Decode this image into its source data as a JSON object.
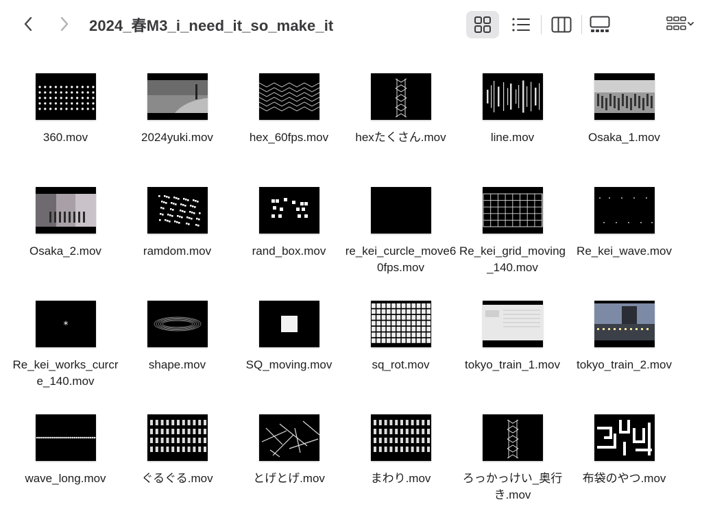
{
  "window": {
    "title": "2024_春M3_i_need_it_so_make_it"
  },
  "toolbar": {
    "back_icon": "chevron-left-icon",
    "forward_icon": "chevron-right-icon",
    "views": [
      {
        "icon": "icon-view-grid-icon",
        "active": true
      },
      {
        "icon": "list-view-icon",
        "active": false
      },
      {
        "icon": "column-view-icon",
        "active": false
      },
      {
        "icon": "gallery-view-icon",
        "active": false
      }
    ],
    "group_icon": "group-by-icon"
  },
  "files": [
    {
      "name": "360.mov",
      "thumb": "dots"
    },
    {
      "name": "2024yuki.mov",
      "thumb": "snow"
    },
    {
      "name": "hex_60fps.mov",
      "thumb": "zigzag"
    },
    {
      "name": "hexたくさん.mov",
      "thumb": "hexchain"
    },
    {
      "name": "line.mov",
      "thumb": "bars"
    },
    {
      "name": "Osaka_1.mov",
      "thumb": "crowd"
    },
    {
      "name": "Osaka_2.mov",
      "thumb": "street"
    },
    {
      "name": "ramdom.mov",
      "thumb": "scatter"
    },
    {
      "name": "rand_box.mov",
      "thumb": "boxes"
    },
    {
      "name": "re_kei_curcle_move60fps.mov",
      "thumb": "black"
    },
    {
      "name": "Re_kei_grid_moving_140.mov",
      "thumb": "grid"
    },
    {
      "name": "Re_kei_wave.mov",
      "thumb": "sparse"
    },
    {
      "name": "Re_kei_works_curcre_140.mov",
      "thumb": "star"
    },
    {
      "name": "shape.mov",
      "thumb": "ring"
    },
    {
      "name": "SQ_moving.mov",
      "thumb": "square"
    },
    {
      "name": "sq_rot.mov",
      "thumb": "dense"
    },
    {
      "name": "tokyo_train_1.mov",
      "thumb": "window"
    },
    {
      "name": "tokyo_train_2.mov",
      "thumb": "building"
    },
    {
      "name": "wave_long.mov",
      "thumb": "waveline"
    },
    {
      "name": "ぐるぐる.mov",
      "thumb": "pillars"
    },
    {
      "name": "とげとげ.mov",
      "thumb": "sticks"
    },
    {
      "name": "まわり.mov",
      "thumb": "pillars2"
    },
    {
      "name": "ろっかっけい_奥行き.mov",
      "thumb": "hexchain2"
    },
    {
      "name": "布袋のやつ.mov",
      "thumb": "maze"
    }
  ]
}
